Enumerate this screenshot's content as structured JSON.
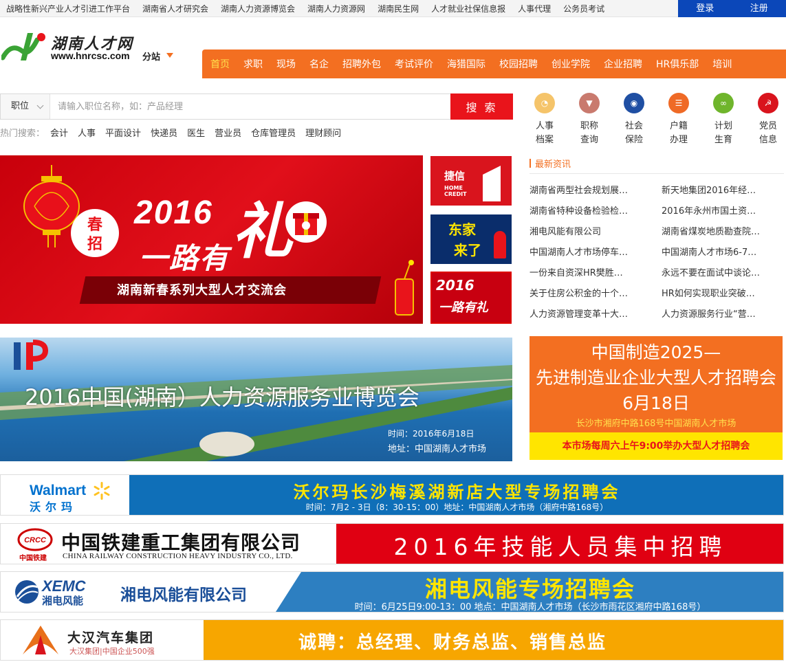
{
  "topbar": {
    "links": [
      "战略性新兴产业人才引进工作平台",
      "湖南省人才研究会",
      "湖南人力资源博览会",
      "湖南人力资源网",
      "湖南民生网",
      "人才就业社保信息报",
      "人事代理",
      "公务员考试"
    ],
    "login": "登录",
    "register": "注册"
  },
  "logo": {
    "title": "湖南人才网",
    "url": "www.hnrcsc.com",
    "branch": "分站"
  },
  "nav": {
    "items": [
      "首页",
      "求职",
      "现场",
      "名企",
      "招聘外包",
      "考试评价",
      "海猎国际",
      "校园招聘",
      "创业学院",
      "企业招聘",
      "HR俱乐部",
      "培训"
    ]
  },
  "search": {
    "type": "职位",
    "placeholder": "请输入职位名称，如：产品经理",
    "button": "搜 索",
    "hot_label": "热门搜索：",
    "hot": [
      "会计",
      "人事",
      "平面设计",
      "快递员",
      "医生",
      "营业员",
      "仓库管理员",
      "理财顾问"
    ]
  },
  "services": [
    {
      "line1": "人事",
      "line2": "档案",
      "color": "#f5c46a",
      "icon": "folder-icon",
      "glyph": "◔"
    },
    {
      "line1": "职称",
      "line2": "查询",
      "color": "#c97a6e",
      "icon": "tie-icon",
      "glyph": "▼"
    },
    {
      "line1": "社会",
      "line2": "保险",
      "color": "#1f4fa3",
      "icon": "eye-icon",
      "glyph": "◉"
    },
    {
      "line1": "户籍",
      "line2": "办理",
      "color": "#ef6a26",
      "icon": "id-card-icon",
      "glyph": "☰"
    },
    {
      "line1": "计划",
      "line2": "生育",
      "color": "#6fb52c",
      "icon": "family-icon",
      "glyph": "∞"
    },
    {
      "line1": "党员",
      "line2": "信息",
      "color": "#d9141d",
      "icon": "party-emblem-icon",
      "glyph": "☭"
    }
  ],
  "news": {
    "heading": "最新资讯",
    "items": [
      "湖南省两型社会规划展…",
      "新天地集团2016年经…",
      "湖南省特种设备检验检…",
      "2016年永州市国土资…",
      "湘电风能有限公司",
      "湖南省煤炭地质勘查院…",
      "中国湖南人才市场停车…",
      "中国湖南人才市场6-7…",
      "一份来自资深HR樊胜…",
      "永远不要在面试中谈论…",
      "关于住房公积金的十个…",
      "HR如何实现职业突破…",
      "人力资源管理变革十大…",
      "人力资源服务行业“营…"
    ]
  },
  "banner_main": {
    "badge": "春招",
    "year": "2016",
    "road": "一路有",
    "li": "礼",
    "ribbon": "湖南新春系列大型人才交流会"
  },
  "thumbs": {
    "t1_title": "捷信",
    "t1_sub1": "HOME",
    "t1_sub2": "CREDIT",
    "t2_title1": "东家",
    "t2_title2": "来了",
    "t3_year": "2016",
    "t3_text": "一路有礼"
  },
  "expo": {
    "title": "2016中国(湖南）人力资源服务业博览会",
    "time": "时间：2016年6月18日",
    "addr": "地址：中国湖南人才市场"
  },
  "mfg": {
    "l1": "中国制造2025—",
    "l2": "先进制造业企业大型人才招聘会",
    "l3": "6月18日",
    "l4": "长沙市湘府中路168号中国湖南人才市场",
    "bottom": "本市场每周六上午9:00举办大型人才招聘会"
  },
  "walmart": {
    "name": "Walmart",
    "cn": "沃尔玛",
    "title": "沃尔玛长沙梅溪湖新店大型专场招聘会",
    "sub": "时间：7月2 - 3日（8：30-15：00）地址：中国湖南人才市场（湘府中路168号）"
  },
  "crcc": {
    "badge": "CRCC",
    "short": "中国铁建",
    "name": "中国铁建重工集团有限公司",
    "en": "CHINA RAILWAY CONSTRUCTION HEAVY INDUSTRY CO., LTD.",
    "title": "2016年技能人员集中招聘"
  },
  "xemc": {
    "logo": "XEMC",
    "cn": "湘电风能",
    "name": "湘电风能有限公司",
    "title": "湘电风能专场招聘会",
    "sub": "时间：6月25日9:00-13：00    地点：中国湖南人才市场（长沙市雨花区湘府中路168号）"
  },
  "dahan": {
    "name": "大汉汽车集团",
    "sub": "大汉集团|中国企业500强",
    "title": "诚聘：总经理、财务总监、销售总监"
  }
}
